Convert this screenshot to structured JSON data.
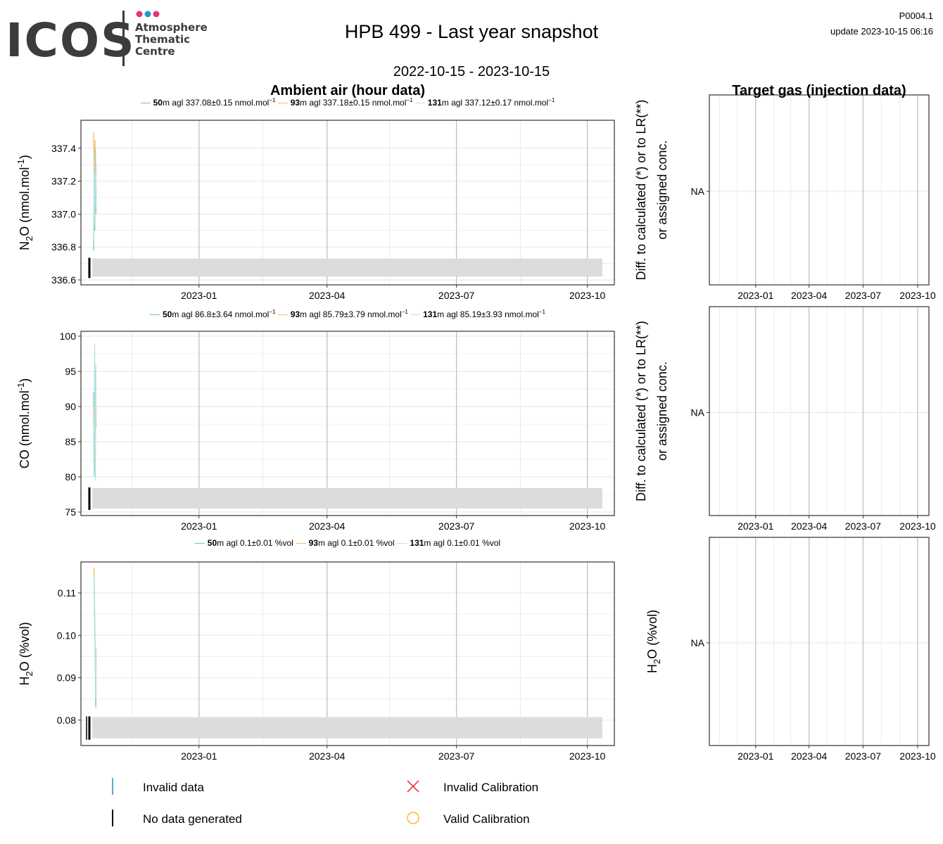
{
  "logo": {
    "brand": "ICOS",
    "subtitle_lines": [
      "Atmosphere",
      "Thematic",
      "Centre"
    ],
    "dot_colors": [
      "#e8336e",
      "#1f9ad6",
      "#e8336e"
    ],
    "brand_color": "#3c3c3c"
  },
  "header": {
    "title": "HPB 499 - Last year snapshot",
    "date_range": "2022-10-15 - 2023-10-15",
    "code": "P0004.1",
    "update_label": "update  2023-10-15 06:16"
  },
  "sections": {
    "left_title": "Ambient air (hour data)",
    "right_title": "Target gas (injection data)"
  },
  "colors": {
    "h50": "#66c2a5",
    "h93": "#fdb462",
    "h131": "#b2e2e2",
    "invalid": "#2b8cbe",
    "nodata": "#000000",
    "invalid_cal": "#e41a1c",
    "valid_cal": "#ffb000",
    "band": "#dcdcdc",
    "grid_major": "#c0c0c0",
    "grid_minor": "#ebebeb"
  },
  "x_axis": {
    "tick_labels": [
      "2023-01",
      "2023-04",
      "2023-07",
      "2023-10"
    ],
    "tick_dates": [
      "2023-01-01",
      "2023-04-01",
      "2023-07-01",
      "2023-10-01"
    ],
    "minor_dates": [
      "2022-11-15",
      "2023-02-15",
      "2023-05-15",
      "2023-08-15"
    ]
  },
  "chart_data": [
    {
      "type": "line",
      "id": "n2o",
      "ylabel_main": "N",
      "ylabel_sub": "2",
      "ylabel_rest": "O (nmol.mol",
      "ylabel_sup": "-1",
      "ylabel_end": ")",
      "ylim": [
        336.57,
        337.57
      ],
      "yticks": [
        336.6,
        336.8,
        337.0,
        337.2,
        337.4
      ],
      "ytick_labels": [
        "336.6",
        "336.8",
        "337.0",
        "337.2",
        "337.4"
      ],
      "legend": [
        {
          "height": "50",
          "rest": "m agl 337.08",
          "pm": "±",
          "err": "0.15 nmol.mol",
          "sup": "−1",
          "color_key": "h50"
        },
        {
          "height": "93",
          "rest": "m agl 337.18",
          "pm": "±",
          "err": "0.15 nmol.mol",
          "sup": "−1",
          "color_key": "h93"
        },
        {
          "height": "131",
          "rest": "m agl 337.12",
          "pm": "±",
          "err": "0.17 nmol.mol",
          "sup": "−1",
          "color_key": "h131"
        }
      ],
      "series": [
        {
          "name": "50m agl",
          "color_key": "h50",
          "x": [
            "2022-10-15",
            "2022-10-16",
            "2022-10-17",
            "2022-10-18",
            "2022-10-19",
            "2022-10-20",
            "2022-10-21",
            "2022-10-22"
          ],
          "y": [
            336.78,
            337.05,
            337.32,
            336.9,
            337.2,
            337.4,
            337.0,
            337.15
          ]
        },
        {
          "name": "93m agl",
          "color_key": "h93",
          "x": [
            "2022-10-15",
            "2022-10-16",
            "2022-10-17",
            "2022-10-18",
            "2022-10-19",
            "2022-10-20",
            "2022-10-21",
            "2022-10-22"
          ],
          "y": [
            337.5,
            337.2,
            336.95,
            337.38,
            337.45,
            337.1,
            337.3,
            337.25
          ]
        },
        {
          "name": "131m agl",
          "color_key": "h131",
          "x": [
            "2022-10-15",
            "2022-10-16",
            "2022-10-17",
            "2022-10-18",
            "2022-10-19",
            "2022-10-20",
            "2022-10-21",
            "2022-10-22"
          ],
          "y": [
            336.85,
            337.15,
            337.4,
            337.0,
            336.92,
            337.25,
            337.05,
            337.3
          ]
        }
      ],
      "band": {
        "from": "2022-10-18",
        "to": "2023-10-15",
        "ymin": 336.62,
        "ymax": 336.73
      },
      "nodata_marks": [
        "2022-10-23"
      ],
      "target_na": "NA",
      "target_ylabel_lines": [
        "Diff. to calculated (*) or to LR(**)",
        "or assigned conc."
      ]
    },
    {
      "type": "line",
      "id": "co",
      "ylabel_main": "CO (nmol.mol",
      "ylabel_sub": "",
      "ylabel_rest": "",
      "ylabel_sup": "-1",
      "ylabel_end": ")",
      "ylim": [
        74.5,
        100.7
      ],
      "yticks": [
        75,
        80,
        85,
        90,
        95,
        100
      ],
      "ytick_labels": [
        "75",
        "80",
        "85",
        "90",
        "95",
        "100"
      ],
      "legend": [
        {
          "height": "50",
          "rest": "m agl 86.8",
          "pm": "±",
          "err": "3.64 nmol.mol",
          "sup": "−1",
          "color_key": "h50"
        },
        {
          "height": "93",
          "rest": "m agl 85.79",
          "pm": "±",
          "err": "3.79 nmol.mol",
          "sup": "−1",
          "color_key": "h93"
        },
        {
          "height": "131",
          "rest": "m agl 85.19",
          "pm": "±",
          "err": "3.93 nmol.mol",
          "sup": "−1",
          "color_key": "h131"
        }
      ],
      "series": [
        {
          "name": "50m agl",
          "color_key": "h50",
          "x": [
            "2022-10-15",
            "2022-10-16",
            "2022-10-17",
            "2022-10-18",
            "2022-10-19",
            "2022-10-20",
            "2022-10-21",
            "2022-10-22"
          ],
          "y": [
            92.0,
            83.0,
            80.0,
            89.0,
            95.0,
            86.0,
            90.0,
            87.5
          ]
        },
        {
          "name": "93m agl",
          "color_key": "h93",
          "x": [
            "2022-10-15",
            "2022-10-16",
            "2022-10-17",
            "2022-10-18",
            "2022-10-19",
            "2022-10-20",
            "2022-10-21",
            "2022-10-22"
          ],
          "y": [
            90.0,
            84.0,
            88.0,
            91.0,
            82.0,
            86.0,
            89.0,
            87.0
          ]
        },
        {
          "name": "131m agl",
          "color_key": "h131",
          "x": [
            "2022-10-15",
            "2022-10-16",
            "2022-10-17",
            "2022-10-18",
            "2022-10-19",
            "2022-10-20",
            "2022-10-21",
            "2022-10-22"
          ],
          "y": [
            88.0,
            80.0,
            92.0,
            99.0,
            85.0,
            79.5,
            96.0,
            88.0
          ]
        }
      ],
      "band": {
        "from": "2022-10-18",
        "to": "2023-10-15",
        "ymin": 75.5,
        "ymax": 78.4
      },
      "nodata_marks": [
        "2022-10-23"
      ],
      "target_na": "NA",
      "target_ylabel_lines": [
        "Diff. to calculated (*) or to LR(**)",
        "or assigned conc."
      ]
    },
    {
      "type": "line",
      "id": "h2o",
      "ylabel_main": "H",
      "ylabel_sub": "2",
      "ylabel_rest": "O (%vol)",
      "ylabel_sup": "",
      "ylabel_end": "",
      "ylim": [
        0.074,
        0.1173
      ],
      "yticks": [
        0.08,
        0.09,
        0.1,
        0.11
      ],
      "ytick_labels": [
        "0.08",
        "0.09",
        "0.10",
        "0.11"
      ],
      "legend": [
        {
          "height": "50",
          "rest": "m agl 0.1",
          "pm": "±",
          "err": "0.01 %vol",
          "sup": "",
          "color_key": "h50"
        },
        {
          "height": "93",
          "rest": "m agl 0.1",
          "pm": "±",
          "err": "0.01 %vol",
          "sup": "",
          "color_key": "h93"
        },
        {
          "height": "131",
          "rest": "m agl 0.1",
          "pm": "±",
          "err": "0.01 %vol",
          "sup": "",
          "color_key": "h131"
        }
      ],
      "series": [
        {
          "name": "50m agl",
          "color_key": "h50",
          "x": [
            "2022-10-16",
            "2022-10-17",
            "2022-10-18",
            "2022-10-19",
            "2022-10-20",
            "2022-10-21",
            "2022-10-22"
          ],
          "y": [
            0.115,
            0.108,
            0.102,
            0.097,
            0.09,
            0.083,
            0.095
          ]
        },
        {
          "name": "93m agl",
          "color_key": "h93",
          "x": [
            "2022-10-16",
            "2022-10-17",
            "2022-10-18",
            "2022-10-19",
            "2022-10-20",
            "2022-10-21",
            "2022-10-22"
          ],
          "y": [
            0.116,
            0.11,
            0.105,
            0.1,
            0.094,
            0.088,
            0.092
          ]
        },
        {
          "name": "131m agl",
          "color_key": "h131",
          "x": [
            "2022-10-16",
            "2022-10-17",
            "2022-10-18",
            "2022-10-19",
            "2022-10-20",
            "2022-10-21",
            "2022-10-22"
          ],
          "y": [
            0.114,
            0.112,
            0.107,
            0.099,
            0.091,
            0.085,
            0.097
          ]
        }
      ],
      "band": {
        "from": "2022-10-18",
        "to": "2023-10-15",
        "ymin": 0.0757,
        "ymax": 0.0807
      },
      "nodata_marks": [
        "2022-10-16",
        "2022-10-23"
      ],
      "target_na": "NA",
      "target_ylabel_lines": [
        "H2O (%vol)"
      ]
    }
  ],
  "legend_bottom": {
    "invalid_data": "Invalid data",
    "no_data": "No data generated",
    "invalid_calibration": "Invalid Calibration",
    "valid_calibration": "Valid Calibration"
  }
}
